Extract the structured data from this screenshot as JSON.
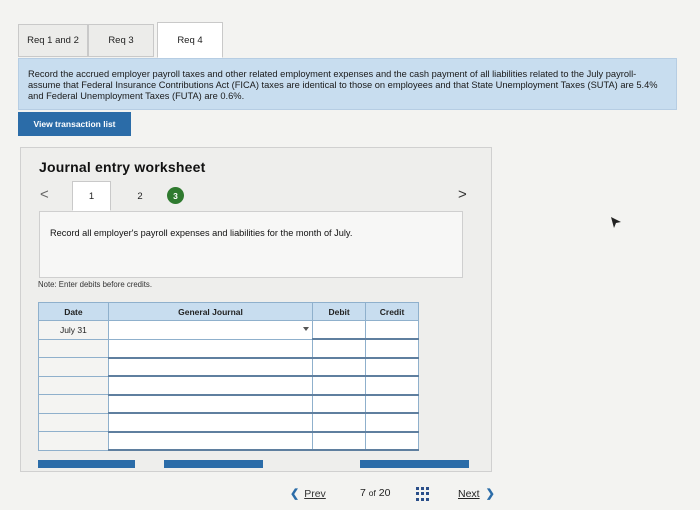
{
  "tabs": [
    {
      "label": "Req 1 and 2"
    },
    {
      "label": "Req 3"
    },
    {
      "label": "Req 4"
    }
  ],
  "instructions": "Record the accrued employer payroll taxes and other related employment expenses and the cash payment of all liabilities related to the July payroll-assume that Federal Insurance Contributions Act (FICA) taxes are identical to those on employees and that State Unemployment Taxes (SUTA) are 5.4% and Federal Unemployment Taxes (FUTA) are 0.6%.",
  "view_transaction_button": "View transaction list",
  "worksheet": {
    "title": "Journal entry worksheet",
    "prev_arrow": "<",
    "next_arrow": ">",
    "steps": [
      "1",
      "2",
      "3"
    ],
    "step_text": "Record all employer's payroll expenses and liabilities for the month of July.",
    "note": "Note: Enter debits before credits.",
    "table": {
      "headers": [
        "Date",
        "General Journal",
        "Debit",
        "Credit"
      ],
      "rows": [
        {
          "date": "July 31"
        },
        {
          "date": ""
        },
        {
          "date": ""
        },
        {
          "date": ""
        },
        {
          "date": ""
        },
        {
          "date": ""
        },
        {
          "date": ""
        }
      ]
    }
  },
  "footer": {
    "prev_label": "Prev",
    "page_current": "7",
    "page_of": "of",
    "page_total": "20",
    "next_label": "Next"
  },
  "colors": {
    "accent_blue": "#2b6ca8",
    "instruction_bg": "#c8ddef",
    "step_done_green": "#2f7a2f"
  }
}
